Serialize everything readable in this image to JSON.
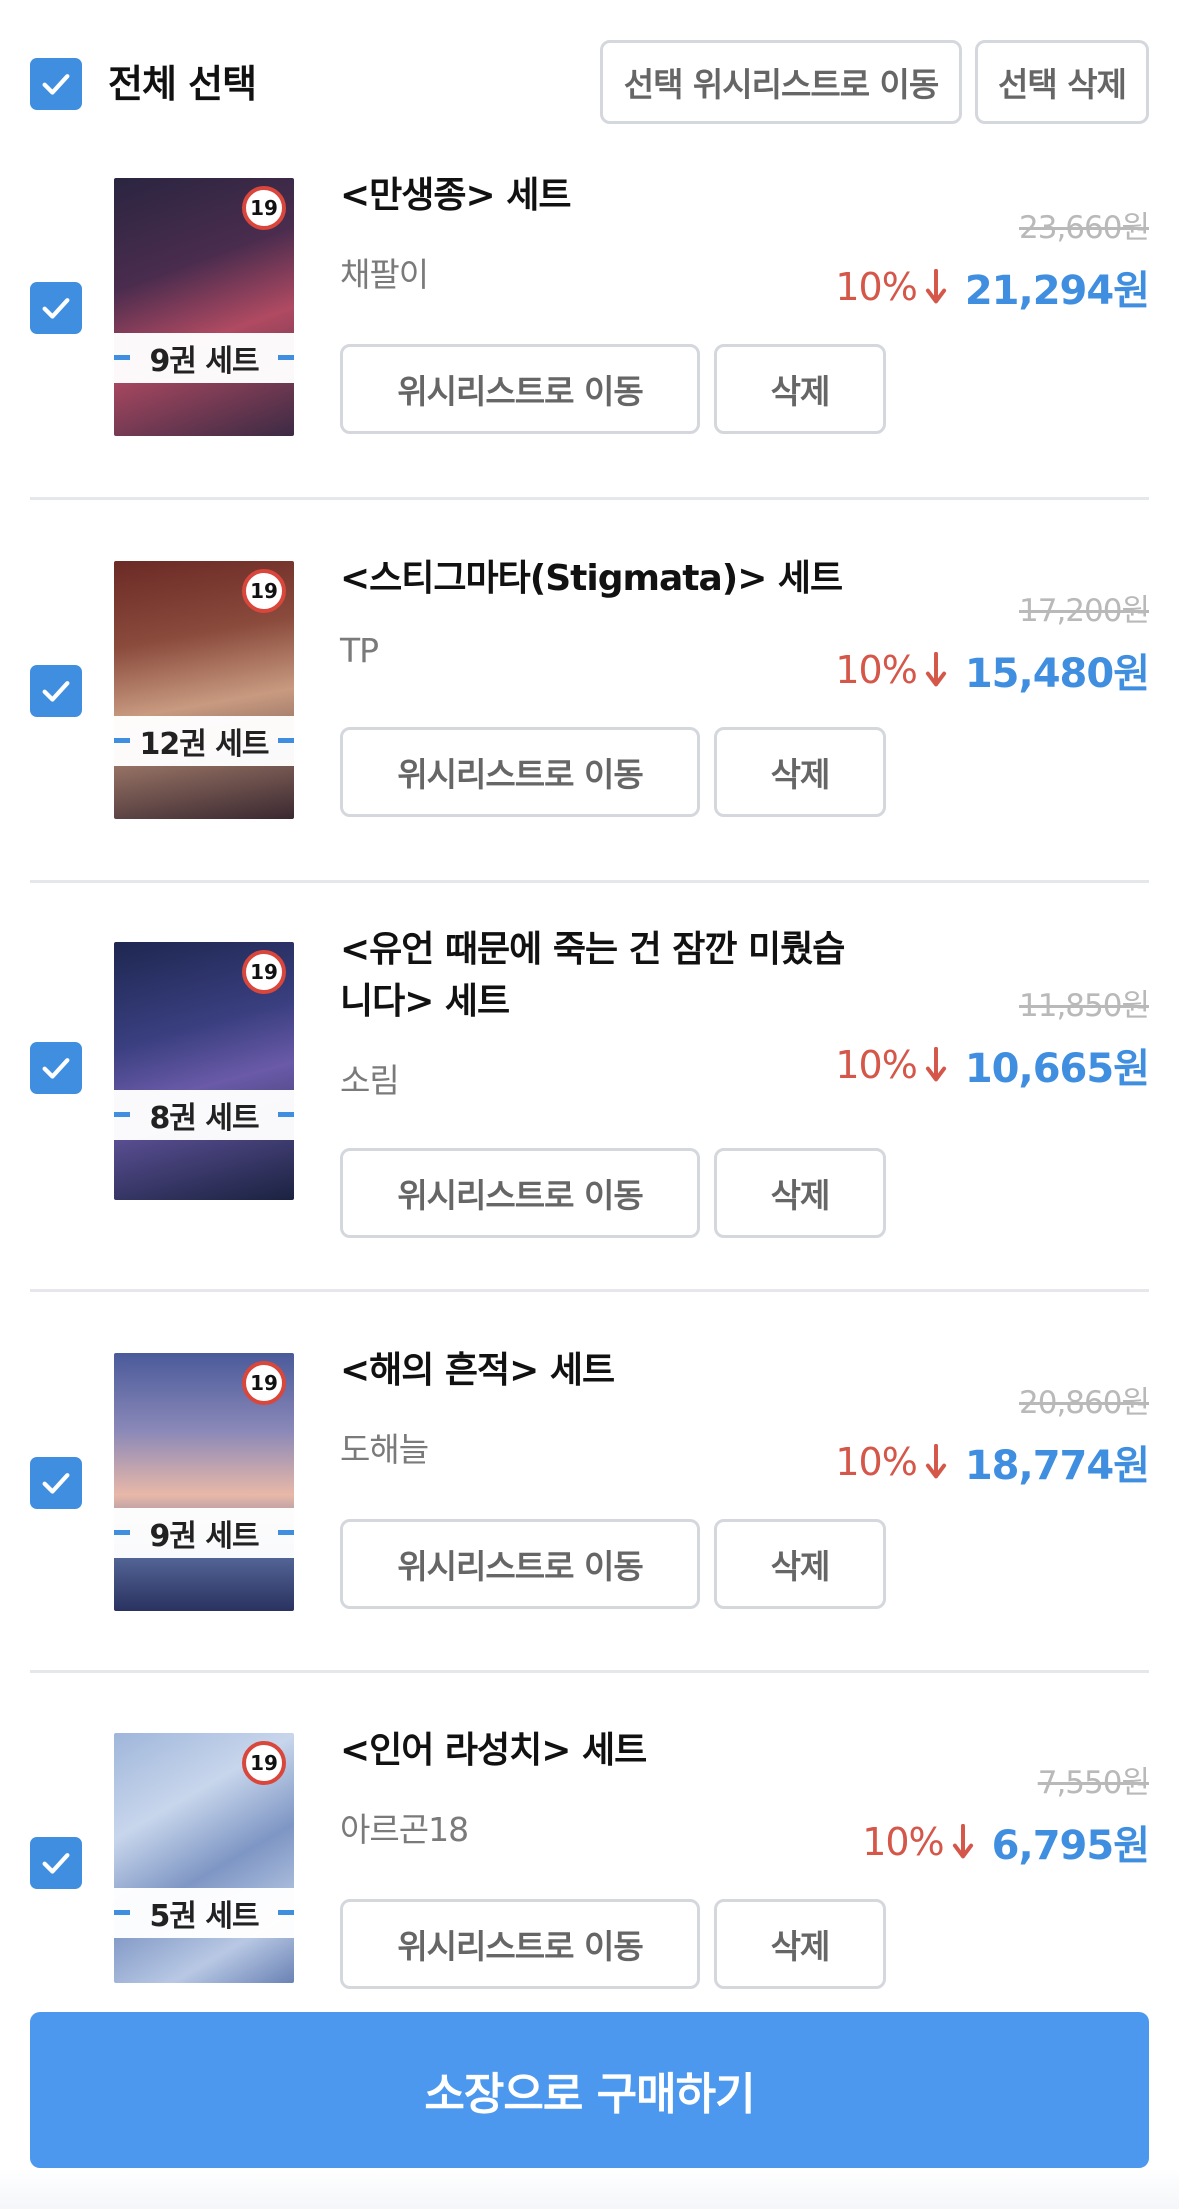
{
  "header": {
    "select_all_label": "전체 선택",
    "move_selected_label": "선택 위시리스트로 이동",
    "delete_selected_label": "선택 삭제"
  },
  "items": [
    {
      "title": "<만생종> 세트",
      "author": "채팔이",
      "set_label": "9권 세트",
      "age_rating": "19",
      "original_price": "23,660원",
      "discount": "10%",
      "sale_price": "21,294원",
      "move_label": "위시리스트로 이동",
      "delete_label": "삭제"
    },
    {
      "title": "<스티그마타(Stigmata)> 세트",
      "author": "TP",
      "set_label": "12권 세트",
      "age_rating": "19",
      "original_price": "17,200원",
      "discount": "10%",
      "sale_price": "15,480원",
      "move_label": "위시리스트로 이동",
      "delete_label": "삭제"
    },
    {
      "title": "<유언 때문에 죽는 건 잠깐 미뤘습니다> 세트",
      "title_line1": "<유언 때문에 죽는 건 잠깐 미뤘습",
      "title_line2": "니다> 세트",
      "author": "소림",
      "set_label": "8권 세트",
      "age_rating": "19",
      "original_price": "11,850원",
      "discount": "10%",
      "sale_price": "10,665원",
      "move_label": "위시리스트로 이동",
      "delete_label": "삭제"
    },
    {
      "title": "<해의 흔적> 세트",
      "author": "도해늘",
      "set_label": "9권 세트",
      "age_rating": "19",
      "original_price": "20,860원",
      "discount": "10%",
      "sale_price": "18,774원",
      "move_label": "위시리스트로 이동",
      "delete_label": "삭제"
    },
    {
      "title": "<인어 라성치> 세트",
      "author": "아르곤18",
      "set_label": "5권 세트",
      "age_rating": "19",
      "original_price": "7,550원",
      "discount": "10%",
      "sale_price": "6,795원",
      "move_label": "위시리스트로 이동",
      "delete_label": "삭제"
    }
  ],
  "footer": {
    "buy_label": "소장으로 구매하기"
  },
  "colors": {
    "accent": "#3f8ee0",
    "buy_button": "#4b98ee",
    "discount_red": "#d4574a",
    "age_badge_red": "#d9463b"
  },
  "icons": {
    "checkbox": "check-icon",
    "discount": "arrow-down-icon"
  }
}
